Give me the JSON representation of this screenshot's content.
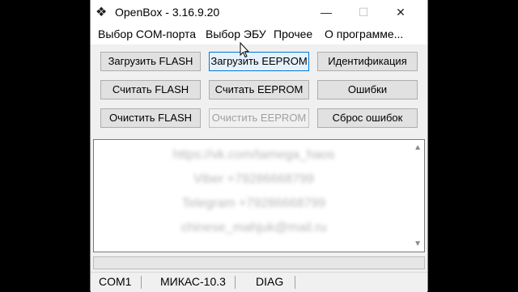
{
  "window": {
    "title": "OpenBox - 3.16.9.20"
  },
  "titlebar": {
    "minimize": "—",
    "maximize": "☐",
    "close": "✕"
  },
  "menu": [
    {
      "label": "Выбор COM-порта"
    },
    {
      "label": "Выбор ЭБУ"
    },
    {
      "label": "Прочее"
    },
    {
      "label": "О программе..."
    }
  ],
  "buttons": {
    "load_flash": "Загрузить FLASH",
    "load_eeprom": "Загрузить EEPROM",
    "identify": "Идентификация",
    "read_flash": "Считать FLASH",
    "read_eeprom": "Считать EEPROM",
    "errors": "Ошибки",
    "clear_flash": "Очистить FLASH",
    "clear_eeprom": "Очистить EEPROM",
    "reset_errors": "Сброс ошибок"
  },
  "log": {
    "lines": [
      "https://vk.com/tamega_haos",
      "Viber +79286668799",
      "Telegram +79286668799",
      "chinese_mahjuk@mail.ru"
    ]
  },
  "progress": {
    "value": 0
  },
  "status": {
    "port": "COM1",
    "ecu": "МИКАС-10.3",
    "mode": "DIAG"
  }
}
